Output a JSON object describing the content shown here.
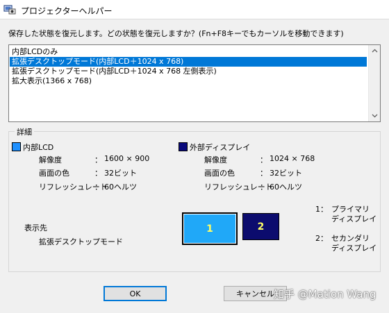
{
  "window": {
    "title": "プロジェクターヘルパー",
    "icon": "projector-helper-icon"
  },
  "instruction": "保存した状態を復元します。どの状態を復元しますか？(Fn+F8キーでもカーソルを移動できます)",
  "list": {
    "items": [
      "内部LCDのみ",
      "拡張デスクトップモード(内部LCD＋1024 x 768)",
      "拡張デスクトップモード(内部LCD＋1024 x 768 左側表示)",
      "拡大表示(1366 x 768)"
    ],
    "selected_index": 1
  },
  "details": {
    "group_title": "詳細",
    "internal": {
      "title": "内部LCD",
      "color": "#1e90ff",
      "resolution_label": "解像度",
      "resolution": "1600 × 900",
      "color_label": "画面の色",
      "color_depth": "32ビット",
      "refresh_label": "リフレッシュレート",
      "refresh": "60ヘルツ"
    },
    "external": {
      "title": "外部ディスプレイ",
      "color": "#0a0a7c",
      "resolution_label": "解像度",
      "resolution": "1024 × 768",
      "color_label": "画面の色",
      "color_depth": "32ビット",
      "refresh_label": "リフレッシュレート",
      "refresh": "60ヘルツ"
    },
    "separator": "：",
    "destination_label": "表示先",
    "destination_value": "拡張デスクトップモード",
    "monitors": {
      "primary": "1",
      "secondary": "2"
    },
    "legend": {
      "primary_num": "1：",
      "primary_line1": "プライマリ",
      "primary_line2": "ディスプレイ",
      "secondary_num": "2：",
      "secondary_line1": "セカンダリ",
      "secondary_line2": "ディスプレイ"
    }
  },
  "buttons": {
    "ok": "OK",
    "cancel": "キャンセル"
  },
  "watermark": "知乎 @Mation Wang"
}
